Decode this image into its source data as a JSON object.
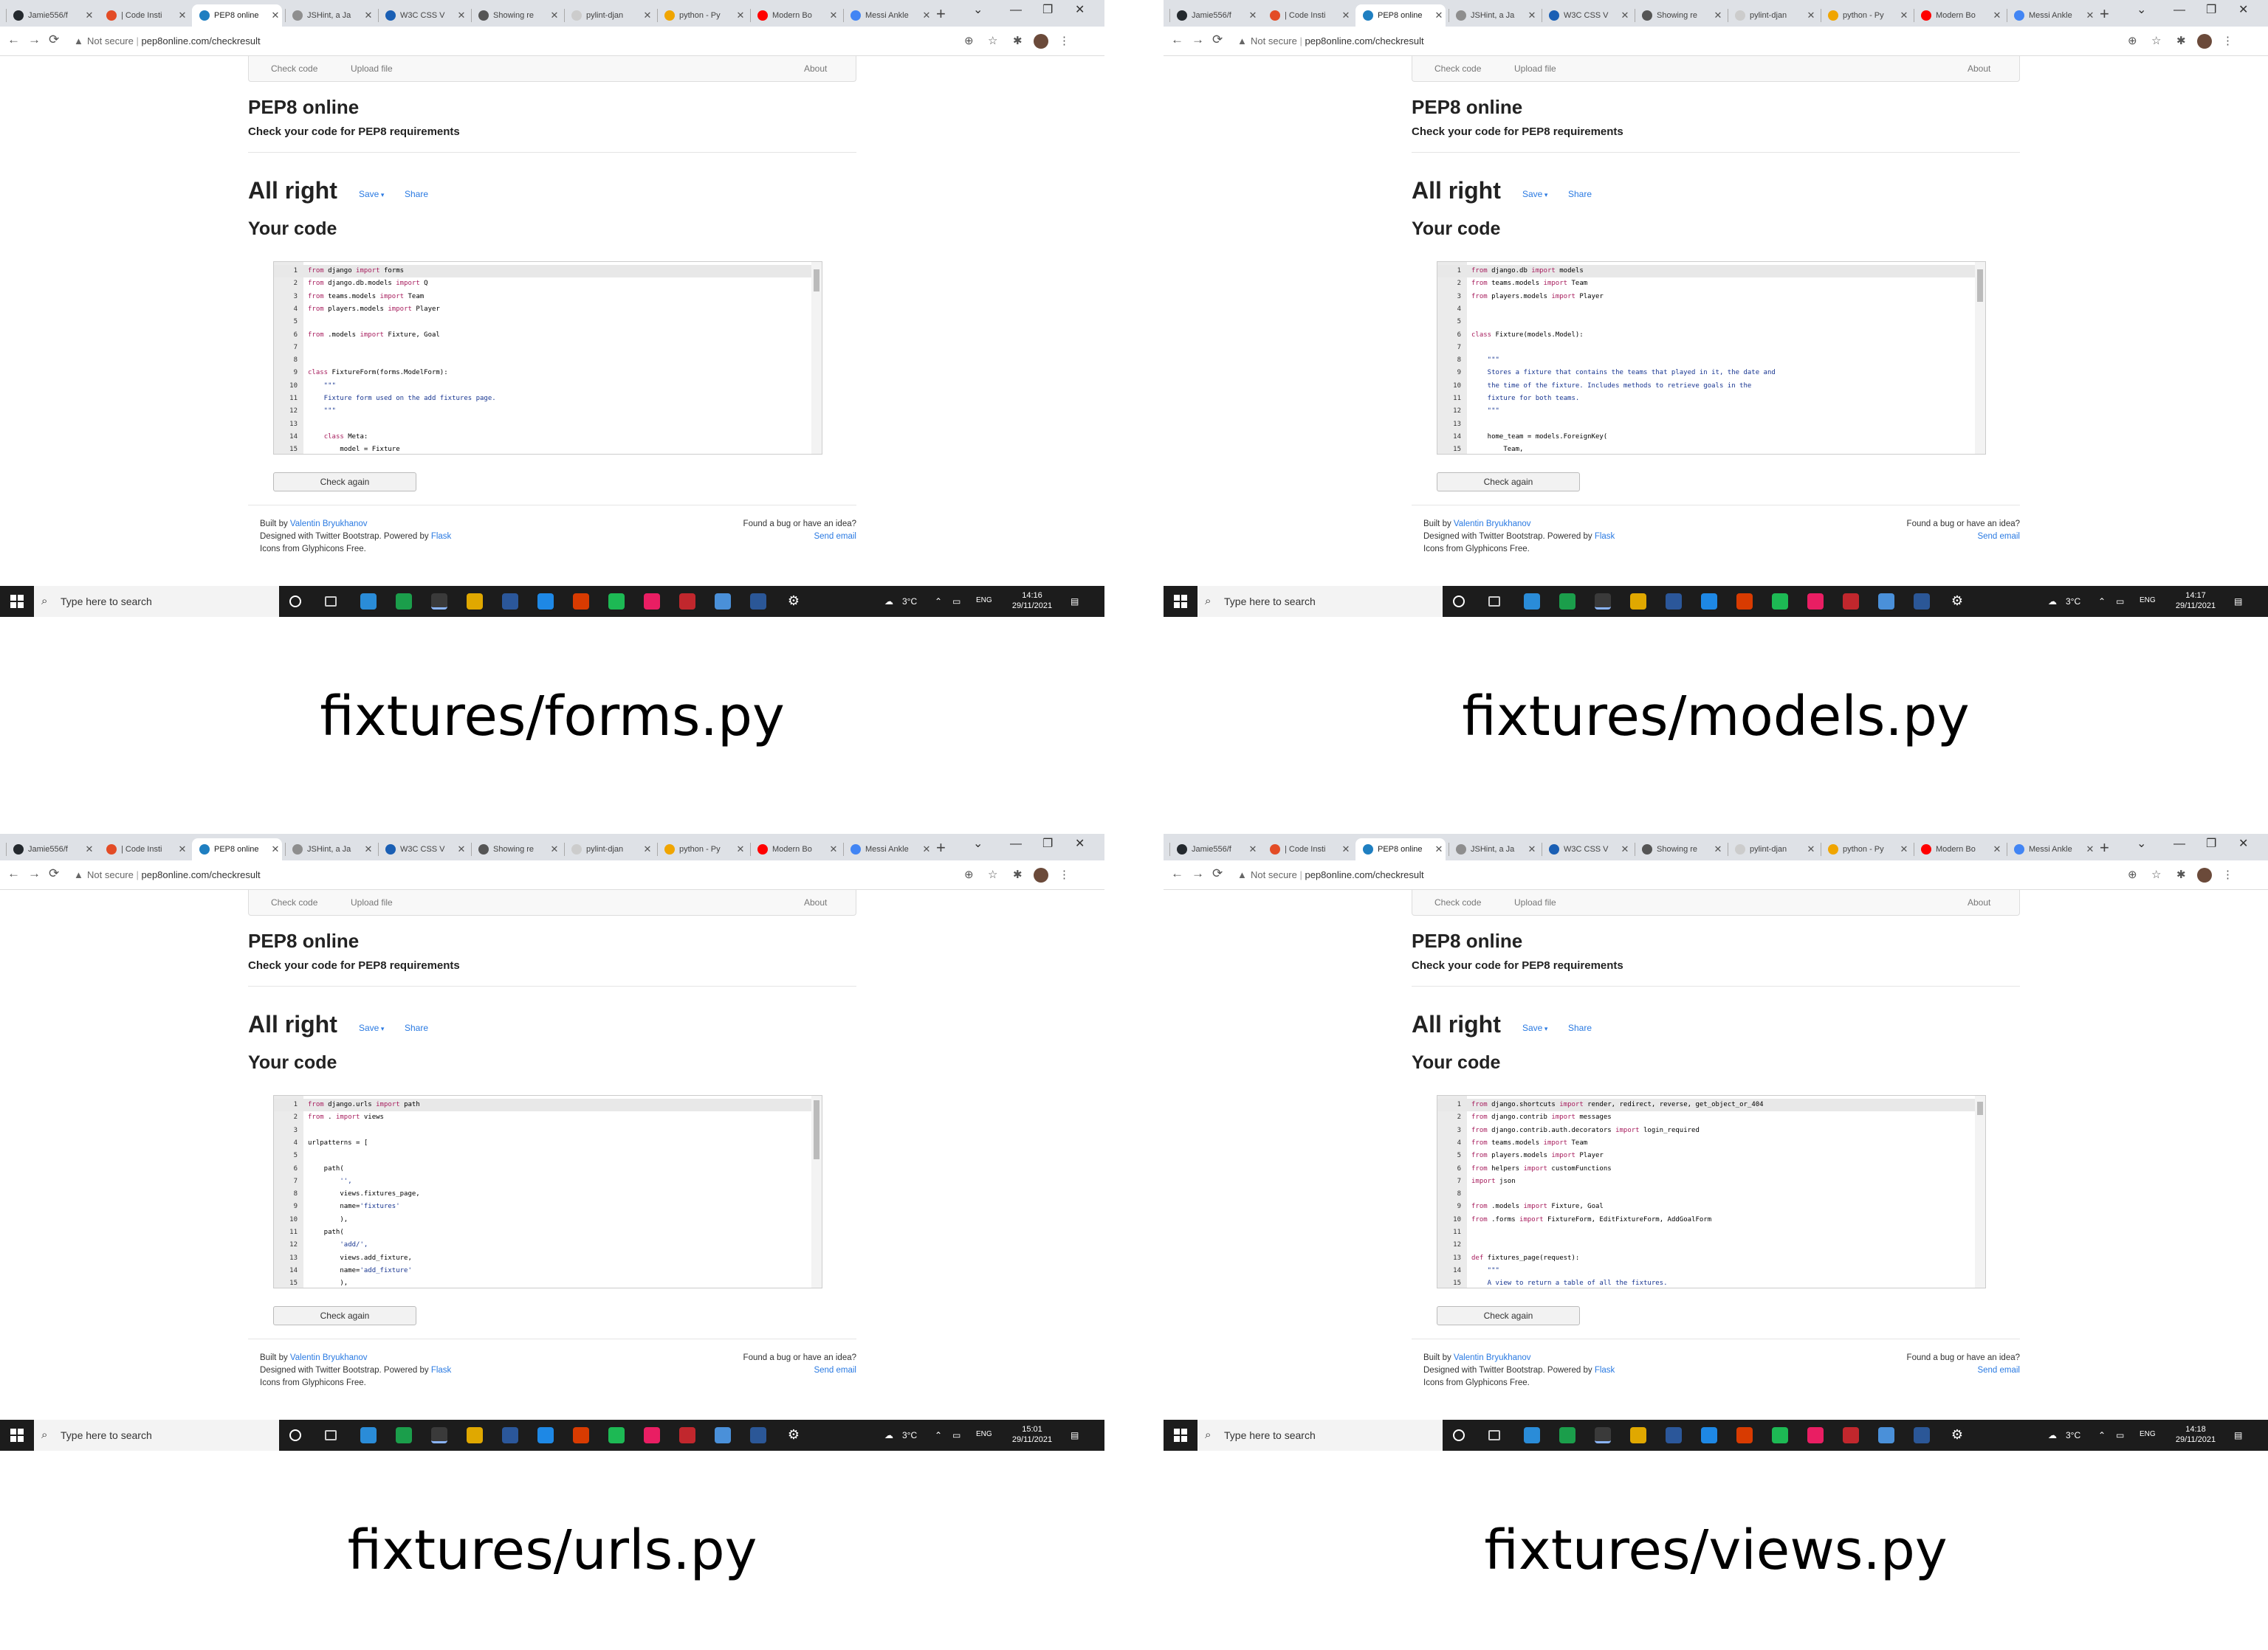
{
  "tabs": [
    "Jamie556/f",
    "| Code Insti",
    "PEP8 online",
    "JSHint, a Ja",
    "W3C CSS V",
    "Showing re",
    "pylint-djan",
    "python - Py",
    "Modern Bo",
    "Messi Ankle"
  ],
  "url": {
    "prefix": "Not secure",
    "value": "pep8online.com/checkresult"
  },
  "navbar": {
    "check": "Check code",
    "upload": "Upload file",
    "about": "About"
  },
  "site": {
    "title": "PEP8 online",
    "subtitle": "Check your code for PEP8 requirements"
  },
  "result": {
    "heading": "All right",
    "save": "Save",
    "share": "Share",
    "your_code": "Your code",
    "check_again": "Check again"
  },
  "footer": {
    "built_by": "Built by",
    "author": "Valentin Bryukhanov",
    "designed": "Designed with Twitter Bootstrap. Powered by",
    "flask": "Flask",
    "icons": "Icons from Glyphicons Free.",
    "bug": "Found a bug or have an idea?",
    "send": "Send email"
  },
  "taskbar": {
    "search": "Type here to search",
    "temp": "3°C",
    "lang": "ENG",
    "date": "29/11/2021"
  },
  "colors": {
    "tabbar": "#dee1e6",
    "link": "#2a7ae2",
    "keyword": "#a71d5d",
    "string": "#183691",
    "taskbar": "#1c1c1c"
  },
  "panels": [
    {
      "caption": "fixtures/forms.py",
      "time": "14:16",
      "code": [
        {
          "n": "1",
          "t": "from django import forms"
        },
        {
          "n": "2",
          "t": "from django.db.models import Q"
        },
        {
          "n": "3",
          "t": "from teams.models import Team"
        },
        {
          "n": "4",
          "t": "from players.models import Player"
        },
        {
          "n": "5",
          "t": ""
        },
        {
          "n": "6",
          "t": "from .models import Fixture, Goal"
        },
        {
          "n": "7",
          "t": ""
        },
        {
          "n": "8",
          "t": ""
        },
        {
          "n": "9",
          "t": "class FixtureForm(forms.ModelForm):"
        },
        {
          "n": "10",
          "t": "    \"\"\""
        },
        {
          "n": "11",
          "t": "    Fixture form used on the add fixtures page."
        },
        {
          "n": "12",
          "t": "    \"\"\""
        },
        {
          "n": "13",
          "t": ""
        },
        {
          "n": "14",
          "t": "    class Meta:"
        },
        {
          "n": "15",
          "t": "        model = Fixture"
        }
      ]
    },
    {
      "caption": "fixtures/models.py",
      "time": "14:17",
      "code": [
        {
          "n": "1",
          "t": "from django.db import models"
        },
        {
          "n": "2",
          "t": "from teams.models import Team"
        },
        {
          "n": "3",
          "t": "from players.models import Player"
        },
        {
          "n": "4",
          "t": ""
        },
        {
          "n": "5",
          "t": ""
        },
        {
          "n": "6",
          "t": "class Fixture(models.Model):"
        },
        {
          "n": "7",
          "t": ""
        },
        {
          "n": "8",
          "t": "    \"\"\""
        },
        {
          "n": "9",
          "t": "    Stores a fixture that contains the teams that played in it, the date and"
        },
        {
          "n": "10",
          "t": "    the time of the fixture. Includes methods to retrieve goals in the"
        },
        {
          "n": "11",
          "t": "    fixture for both teams."
        },
        {
          "n": "12",
          "t": "    \"\"\""
        },
        {
          "n": "13",
          "t": ""
        },
        {
          "n": "14",
          "t": "    home_team = models.ForeignKey("
        },
        {
          "n": "15",
          "t": "        Team,"
        }
      ]
    },
    {
      "caption": "fixtures/urls.py",
      "time": "15:01",
      "code": [
        {
          "n": "1",
          "t": "from django.urls import path"
        },
        {
          "n": "2",
          "t": "from . import views"
        },
        {
          "n": "3",
          "t": ""
        },
        {
          "n": "4",
          "t": "urlpatterns = ["
        },
        {
          "n": "5",
          "t": ""
        },
        {
          "n": "6",
          "t": "    path("
        },
        {
          "n": "7",
          "t": "        '',"
        },
        {
          "n": "8",
          "t": "        views.fixtures_page,"
        },
        {
          "n": "9",
          "t": "        name='fixtures'"
        },
        {
          "n": "10",
          "t": "        ),"
        },
        {
          "n": "11",
          "t": "    path("
        },
        {
          "n": "12",
          "t": "        'add/',"
        },
        {
          "n": "13",
          "t": "        views.add_fixture,"
        },
        {
          "n": "14",
          "t": "        name='add_fixture'"
        },
        {
          "n": "15",
          "t": "        ),"
        }
      ]
    },
    {
      "caption": "fixtures/views.py",
      "time": "14:18",
      "code": [
        {
          "n": "1",
          "t": "from django.shortcuts import render, redirect, reverse, get_object_or_404"
        },
        {
          "n": "2",
          "t": "from django.contrib import messages"
        },
        {
          "n": "3",
          "t": "from django.contrib.auth.decorators import login_required"
        },
        {
          "n": "4",
          "t": "from teams.models import Team"
        },
        {
          "n": "5",
          "t": "from players.models import Player"
        },
        {
          "n": "6",
          "t": "from helpers import customFunctions"
        },
        {
          "n": "7",
          "t": "import json"
        },
        {
          "n": "8",
          "t": ""
        },
        {
          "n": "9",
          "t": "from .models import Fixture, Goal"
        },
        {
          "n": "10",
          "t": "from .forms import FixtureForm, EditFixtureForm, AddGoalForm"
        },
        {
          "n": "11",
          "t": ""
        },
        {
          "n": "12",
          "t": ""
        },
        {
          "n": "13",
          "t": "def fixtures_page(request):"
        },
        {
          "n": "14",
          "t": "    \"\"\""
        },
        {
          "n": "15",
          "t": "    A view to return a table of all the fixtures."
        }
      ]
    }
  ]
}
